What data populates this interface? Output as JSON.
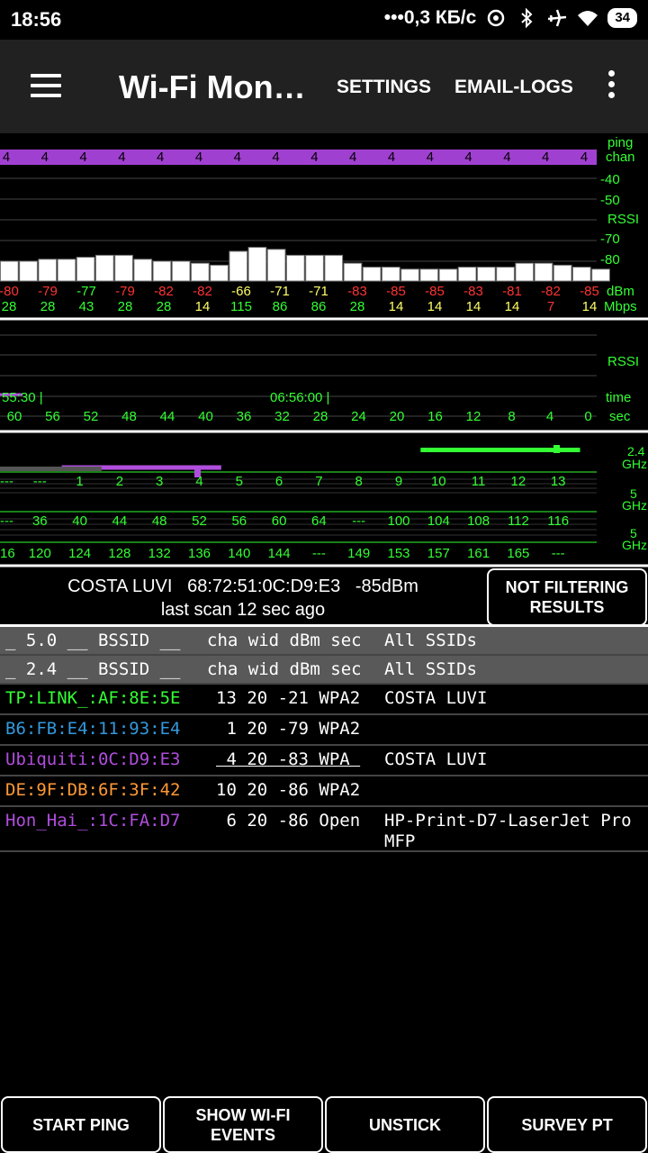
{
  "status_bar": {
    "time": "18:56",
    "speed": "•••0,3 КБ/с",
    "battery": "34",
    "icons": [
      "hotspot-icon",
      "bluetooth-icon",
      "airplane-icon",
      "wifi-icon",
      "battery-icon"
    ]
  },
  "app_bar": {
    "title": "Wi-Fi Monitor",
    "settings_label": "SETTINGS",
    "email_logs_label": "EMAIL-LOGS"
  },
  "colors": {
    "green": "#33ff33",
    "red": "#ff3333",
    "yellow": "#ffff66",
    "purple": "#b04ddd",
    "blue": "#3399dd",
    "orange": "#ff9933",
    "header_bg": "#595959"
  },
  "rssi_panel": {
    "ping_label": "ping",
    "chan_label": "chan",
    "rssi_label": "RSSI",
    "dbm_label": "dBm",
    "mbps_label": "Mbps",
    "scale_labels": [
      "-40",
      "-50",
      "-70",
      "-80"
    ],
    "chan_values": [
      "4",
      "4",
      "4",
      "4",
      "4",
      "4",
      "4",
      "4",
      "4",
      "4",
      "4",
      "4",
      "4",
      "4",
      "4",
      "4"
    ],
    "dbm_values": [
      "-80",
      "-79",
      "-77",
      "-79",
      "-82",
      "-82",
      "-66",
      "-71",
      "-71",
      "-83",
      "-85",
      "-85",
      "-83",
      "-81",
      "-82",
      "-85"
    ],
    "mbps_values": [
      "28",
      "28",
      "43",
      "28",
      "28",
      "14",
      "115",
      "86",
      "86",
      "28",
      "14",
      "14",
      "14",
      "14",
      "7",
      "14"
    ],
    "bar_rssi": [
      -80,
      -80,
      -79,
      -79,
      -78,
      -77,
      -77,
      -79,
      -80,
      -80,
      -81,
      -82,
      -75,
      -73,
      -74,
      -77,
      -77,
      -77,
      -81,
      -83,
      -83,
      -84,
      -84,
      -84,
      -83,
      -83,
      -83,
      -81,
      -81,
      -82,
      -83,
      -84
    ]
  },
  "time_panel": {
    "rssi_label": "RSSI",
    "time_label": "time",
    "sec_label": "sec",
    "time_marks": [
      "55:30 |",
      "06:56:00 |"
    ],
    "sec_values": [
      "60",
      "56",
      "52",
      "48",
      "44",
      "40",
      "36",
      "32",
      "28",
      "24",
      "20",
      "16",
      "12",
      "8",
      "4",
      "0"
    ]
  },
  "channel_panel": {
    "band_24_label": "2.4",
    "band_5_label": "5",
    "ghz_label": "GHz",
    "row_24": [
      "---",
      "---",
      "1",
      "2",
      "3",
      "4",
      "5",
      "6",
      "7",
      "8",
      "9",
      "10",
      "11",
      "12",
      "13"
    ],
    "row_5a": [
      "---",
      "36",
      "40",
      "44",
      "48",
      "52",
      "56",
      "60",
      "64",
      "---",
      "100",
      "104",
      "108",
      "112",
      "116"
    ],
    "row_5b": [
      "16",
      "120",
      "124",
      "128",
      "132",
      "136",
      "140",
      "144",
      "---",
      "149",
      "153",
      "157",
      "161",
      "165",
      "---"
    ],
    "networks": [
      {
        "ch_start": 11,
        "ch_end": 15,
        "color": "#33ff33",
        "level": 0.9
      },
      {
        "ch_start": 2,
        "ch_end": 6,
        "color": "#b04ddd",
        "level": 0.25
      },
      {
        "ch_start": 0,
        "ch_end": 3,
        "color": "#555555",
        "level": 0.2
      }
    ]
  },
  "info": {
    "network_line": "COSTA LUVI   68:72:51:0C:D9:E3   -85dBm",
    "scan_line": "last scan 12 sec ago",
    "filter_label": "NOT FILTERING RESULTS"
  },
  "table": {
    "headers": [
      {
        "id": "_ 5.0 __ BSSID __",
        "cols": "cha wid dBm sec",
        "ssid": "All SSIDs"
      },
      {
        "id": "_ 2.4 __ BSSID __",
        "cols": "cha wid dBm sec",
        "ssid": "All SSIDs"
      }
    ],
    "rows": [
      {
        "id": "TP:LINK_:AF:8E:5E",
        "cols": "13 20 -21 WPA2",
        "ssid": "COSTA LUVI",
        "color": "#33ff33"
      },
      {
        "id": "B6:FB:E4:11:93:E4",
        "cols": " 1 20 -79 WPA2",
        "ssid": "",
        "color": "#3399dd"
      },
      {
        "id": "Ubiquiti:0C:D9:E3",
        "cols": " 4 20 -83 WPA ",
        "ssid": "COSTA LUVI",
        "color": "#b04ddd"
      },
      {
        "id": "DE:9F:DB:6F:3F:42",
        "cols": "10 20 -86 WPA2",
        "ssid": "",
        "color": "#ff9933"
      },
      {
        "id": "Hon_Hai_:1C:FA:D7",
        "cols": " 6 20 -86 Open",
        "ssid": "HP-Print-D7-LaserJet Pro MFP",
        "color": "#b04ddd"
      }
    ]
  },
  "bottom_buttons": {
    "start_ping": "START PING",
    "show_events": "SHOW WI-FI EVENTS",
    "unstick": "UNSTICK",
    "survey": "SURVEY PT"
  }
}
